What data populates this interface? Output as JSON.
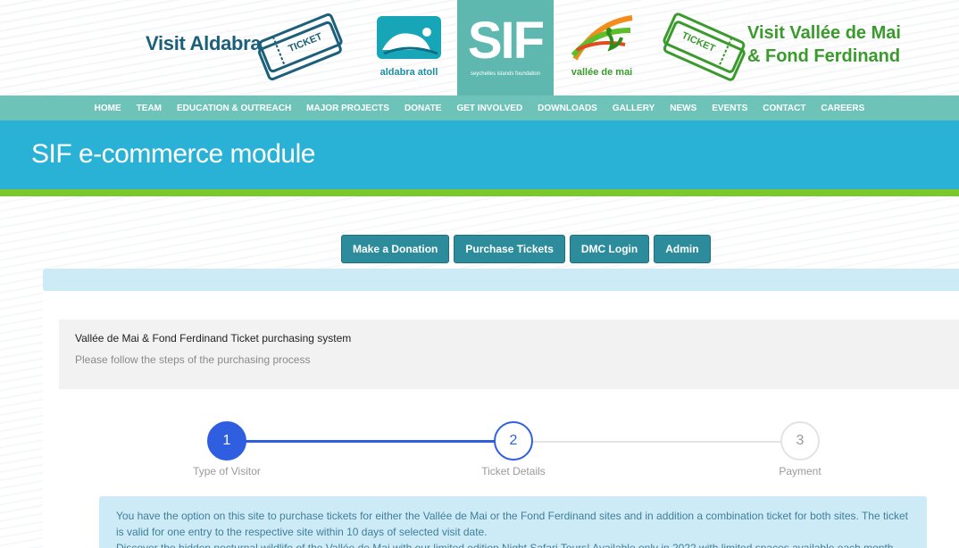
{
  "header": {
    "left_brand": "Visit Aldabra",
    "ticket_word": "TICKET",
    "aldabra_logo_text": "aldabra atoll",
    "sif_letters": "SIF",
    "sif_subtitle": "seychelles islands foundation",
    "vallee_logo_text": "vallée de mai",
    "right_brand_line1": "Visit Vallée de Mai",
    "right_brand_line2": "& Fond Ferdinand"
  },
  "nav": {
    "items": [
      "HOME",
      "TEAM",
      "EDUCATION & OUTREACH",
      "MAJOR PROJECTS",
      "DONATE",
      "GET INVOLVED",
      "DOWNLOADS",
      "GALLERY",
      "NEWS",
      "EVENTS",
      "CONTACT",
      "CAREERS"
    ]
  },
  "banner": {
    "title": "SIF e-commerce module"
  },
  "actions": {
    "donation": "Make a Donation",
    "purchase": "Purchase Tickets",
    "dmc_login": "DMC Login",
    "admin": "Admin"
  },
  "info": {
    "title": "Vallée de Mai & Fond Ferdinand Ticket purchasing system",
    "subtitle": "Please follow the steps of the purchasing process"
  },
  "stepper": {
    "steps": [
      {
        "number": "1",
        "label": "Type of Visitor"
      },
      {
        "number": "2",
        "label": "Ticket Details"
      },
      {
        "number": "3",
        "label": "Payment"
      }
    ]
  },
  "description": {
    "line1": "You have the option on this site to purchase tickets for either the Vallée de Mai or the Fond Ferdinand sites and in addition a combination ticket for both sites. The ticket is valid for one entry to the respective site within 10 days of selected visit date.",
    "line2": "Discover the hidden nocturnal wildlife of the Vallée de Mai with our limited edition Night Safari Tours! Available only in 2022 with limited spaces available each month. Night"
  },
  "colors": {
    "nav_bg": "#6ec3b9",
    "banner_bg": "#29b2d6",
    "accent_green": "#7ac82e",
    "button_bg": "#2d8c9c",
    "step_active": "#2f5fe0",
    "info_bg": "#cdeaf7"
  }
}
